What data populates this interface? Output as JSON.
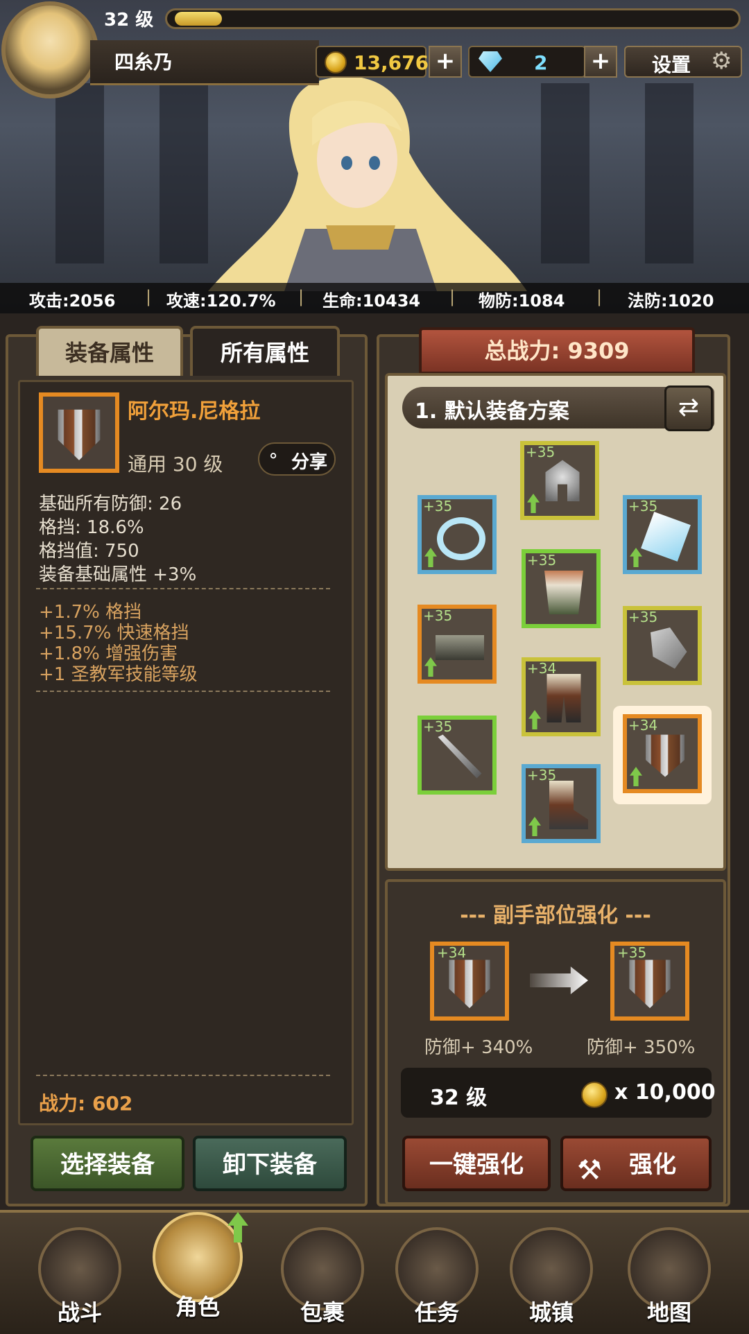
{
  "header": {
    "level": "32 级",
    "player_name": "四糸乃",
    "gold": "13,676",
    "gems": "2",
    "plus": "+",
    "settings_label": "设置"
  },
  "stats": [
    {
      "text": "攻击:2056"
    },
    {
      "text": "攻速:120.7%"
    },
    {
      "text": "生命:10434"
    },
    {
      "text": "物防:1084"
    },
    {
      "text": "法防:1020"
    }
  ],
  "left_panel": {
    "tab_equip": "装备属性",
    "tab_all": "所有属性",
    "item_name": "阿尔玛.尼格拉",
    "item_type": "通用 30 级",
    "share_label": "分享",
    "base_stats": [
      "基础所有防御:  26",
      "格挡:  18.6%",
      "格挡值:  750",
      "装备基础属性 +3%"
    ],
    "bonus_stats": [
      "+1.7% 格挡",
      "+15.7% 快速格挡",
      "+1.8% 增强伤害",
      "+1 圣教军技能等级"
    ],
    "power": "战力: 602",
    "btn_select": "选择装备",
    "btn_unequip": "卸下装备"
  },
  "right_panel": {
    "total_power": "总战力: 9309",
    "loadout_title": "1. 默认装备方案",
    "swap_icon": "⇄",
    "slots": [
      {
        "level": "+35"
      },
      {
        "level": "+35"
      },
      {
        "level": "+35"
      },
      {
        "level": "+35"
      },
      {
        "level": "+35"
      },
      {
        "level": "+35"
      },
      {
        "level": "+34"
      },
      {
        "level": "+35"
      },
      {
        "level": "+34"
      },
      {
        "level": "+35"
      }
    ],
    "upgrade_title": "--- 副手部位强化 ---",
    "from_level": "+34",
    "to_level": "+35",
    "from_stat": "防御+ 340%",
    "to_stat": "防御+ 350%",
    "req_level": "32 级",
    "cost": "x 10,000",
    "btn_auto": "一键强化",
    "btn_enhance": "强化"
  },
  "nav": [
    "战斗",
    "角色",
    "包裹",
    "任务",
    "城镇",
    "地图"
  ]
}
